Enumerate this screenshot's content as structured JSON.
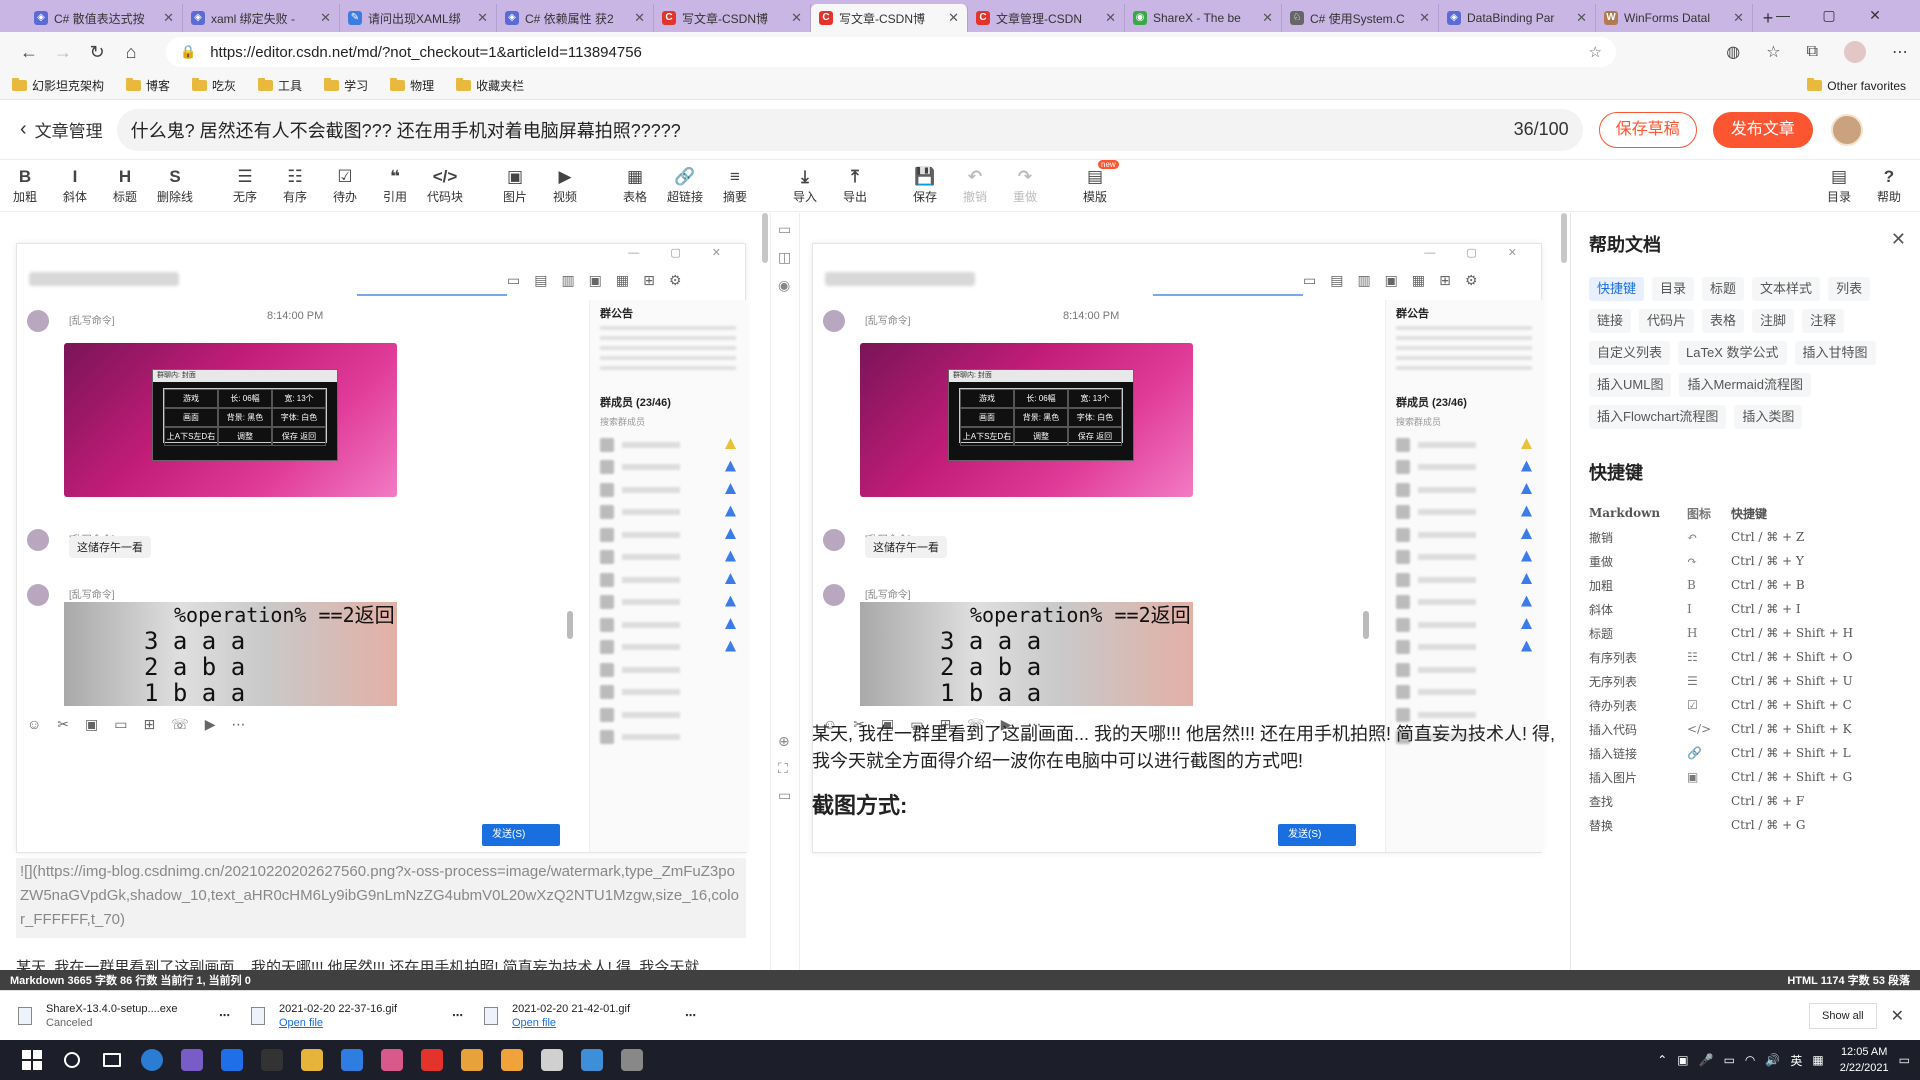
{
  "browser": {
    "tabs": [
      {
        "title": "C# 散值表达式按",
        "fav_color": "#5b6bd6",
        "fav_glyph": "◈",
        "active": false
      },
      {
        "title": "xaml 绑定失败 -",
        "fav_color": "#5b6bd6",
        "fav_glyph": "◈",
        "active": false
      },
      {
        "title": "请问出现XAML绑",
        "fav_color": "#3d7de0",
        "fav_glyph": "✎",
        "active": false
      },
      {
        "title": "C# 依赖属性 获2",
        "fav_color": "#5b6bd6",
        "fav_glyph": "◈",
        "active": false
      },
      {
        "title": "写文章-CSDN博",
        "fav_color": "#e4332a",
        "fav_glyph": "C",
        "active": false
      },
      {
        "title": "写文章-CSDN博",
        "fav_color": "#e4332a",
        "fav_glyph": "C",
        "active": true
      },
      {
        "title": "文章管理-CSDN",
        "fav_color": "#e4332a",
        "fav_glyph": "C",
        "active": false
      },
      {
        "title": "ShareX - The be",
        "fav_color": "#3aa848",
        "fav_glyph": "◉",
        "active": false
      },
      {
        "title": "C# 使用System.C",
        "fav_color": "#666666",
        "fav_glyph": "♘",
        "active": false
      },
      {
        "title": "DataBinding Par",
        "fav_color": "#5b6bd6",
        "fav_glyph": "◈",
        "active": false
      },
      {
        "title": "WinForms Datal",
        "fav_color": "#b07a55",
        "fav_glyph": "W",
        "active": false
      }
    ],
    "new_tab": "+",
    "url": "https://editor.csdn.net/md/?not_checkout=1&articleId=113894756",
    "bookmarks": [
      "幻影坦克架构",
      "博客",
      "吃灰",
      "工具",
      "学习",
      "物理",
      "收藏夹栏"
    ],
    "other_favorites": "Other favorites"
  },
  "editor": {
    "back_label": "文章管理",
    "title": "什么鬼? 居然还有人不会截图??? 还在用手机对着电脑屏幕拍照?????",
    "title_count": "36/100",
    "save_draft": "保存草稿",
    "publish": "发布文章",
    "toolbar": [
      {
        "icon": "B",
        "label": "加粗"
      },
      {
        "icon": "I",
        "label": "斜体"
      },
      {
        "icon": "H",
        "label": "标题"
      },
      {
        "icon": "S",
        "label": "删除线"
      },
      {
        "icon": "☰",
        "label": "无序"
      },
      {
        "icon": "☷",
        "label": "有序"
      },
      {
        "icon": "☑",
        "label": "待办"
      },
      {
        "icon": "❝",
        "label": "引用"
      },
      {
        "icon": "</>",
        "label": "代码块"
      },
      {
        "icon": "▣",
        "label": "图片"
      },
      {
        "icon": "▶",
        "label": "视频"
      },
      {
        "icon": "▦",
        "label": "表格"
      },
      {
        "icon": "🔗",
        "label": "超链接"
      },
      {
        "icon": "≡",
        "label": "摘要"
      },
      {
        "icon": "⤓",
        "label": "导入"
      },
      {
        "icon": "⤒",
        "label": "导出"
      },
      {
        "icon": "💾",
        "label": "保存"
      },
      {
        "icon": "↶",
        "label": "撤销"
      },
      {
        "icon": "↷",
        "label": "重做"
      },
      {
        "icon": "▤",
        "label": "模版"
      }
    ],
    "toolbar_new_badge": "new",
    "toolbar_right": [
      {
        "icon": "▤",
        "label": "目录"
      },
      {
        "icon": "?",
        "label": "帮助"
      }
    ],
    "md_source": "![](https://img-blog.csdnimg.cn/20210220202627560.png?x-oss-process=image/watermark,type_ZmFuZ3poZW5naGVpdGk,shadow_10,text_aHR0cHM6Ly9ibG9nLmNzZG4ubmV0L20wXzQ2NTU1Mzgw,size_16,color_FFFFFF,t_70)",
    "md_body": "某天, 我在一群里看到了这副画面... 我的天哪!!! 他居然!!! 还在用手机拍照! 简直妄为技术人! 得, 我今天就",
    "preview_body": "某天, 我在一群里看到了这副画面... 我的天哪!!! 他居然!!! 还在用手机拍照! 简直妄为技术人! 得, 我今天就全方面得介绍一波你在电脑中可以进行截图的方式吧!",
    "preview_heading": "截图方式:"
  },
  "chat_mock": {
    "time": "8:14:00 PM",
    "sender": "[乱写命令]",
    "bubble": "这储存午一看",
    "group_notice": "群公告",
    "members": "群成员 (23/46)",
    "search_members": "搜索群成员",
    "send": "发送(S)",
    "dialog_title": "群聊内: 封面",
    "dialog_cells": [
      "游戏",
      "长: 06幅",
      "宽: 13个",
      "画面",
      "背景: 黑色",
      "字体: 白色",
      "上A下S左D右",
      "调整",
      "保存 返回"
    ],
    "code_lines": [
      "%operation% ==2返回",
      "3  a  a  a",
      "2  a  b  a",
      "1  b  a  a"
    ]
  },
  "help": {
    "title": "帮助文档",
    "tags": [
      "快捷键",
      "目录",
      "标题",
      "文本样式",
      "列表",
      "链接",
      "代码片",
      "表格",
      "注脚",
      "注释",
      "自定义列表",
      "LaTeX 数学公式",
      "插入甘特图",
      "插入UML图",
      "插入Mermaid流程图",
      "插入Flowchart流程图",
      "插入类图"
    ],
    "shortcut_title": "快捷键",
    "shortcut_headers": [
      "Markdown",
      "图标",
      "快捷键"
    ],
    "shortcuts": [
      {
        "name": "撤销",
        "icon": "↶",
        "key": "Ctrl / ⌘ + Z"
      },
      {
        "name": "重做",
        "icon": "↷",
        "key": "Ctrl / ⌘ + Y"
      },
      {
        "name": "加粗",
        "icon": "B",
        "key": "Ctrl / ⌘ + B"
      },
      {
        "name": "斜体",
        "icon": "I",
        "key": "Ctrl / ⌘ + I"
      },
      {
        "name": "标题",
        "icon": "H",
        "key": "Ctrl / ⌘ + Shift + H"
      },
      {
        "name": "有序列表",
        "icon": "☷",
        "key": "Ctrl / ⌘ + Shift + O"
      },
      {
        "name": "无序列表",
        "icon": "☰",
        "key": "Ctrl / ⌘ + Shift + U"
      },
      {
        "name": "待办列表",
        "icon": "☑",
        "key": "Ctrl / ⌘ + Shift + C"
      },
      {
        "name": "插入代码",
        "icon": "</>",
        "key": "Ctrl / ⌘ + Shift + K"
      },
      {
        "name": "插入链接",
        "icon": "🔗",
        "key": "Ctrl / ⌘ + Shift + L"
      },
      {
        "name": "插入图片",
        "icon": "▣",
        "key": "Ctrl / ⌘ + Shift + G"
      },
      {
        "name": "查找",
        "icon": "",
        "key": "Ctrl / ⌘ + F"
      },
      {
        "name": "替换",
        "icon": "",
        "key": "Ctrl / ⌘ + G"
      }
    ]
  },
  "status": {
    "left": "Markdown  3665 字数  86 行数  当前行 1, 当前列 0",
    "right": "HTML  1174 字数  53 段落"
  },
  "downloads": [
    {
      "name": "ShareX-13.4.0-setup....exe",
      "status": "Canceled",
      "link": false
    },
    {
      "name": "2021-02-20 22-37-16.gif",
      "status": "Open file",
      "link": true
    },
    {
      "name": "2021-02-20 21-42-01.gif",
      "status": "Open file",
      "link": true
    }
  ],
  "show_all": "Show all",
  "taskbar": {
    "apps": [
      "#2b7cd3",
      "#7a5cc8",
      "#1f6fe8",
      "#333333",
      "#e6b43a",
      "#2f7de1",
      "#d95a8a",
      "#e4332a",
      "#e8a23b",
      "#f0a23b",
      "#d0d0d0",
      "#3f8fd8",
      "#888888"
    ],
    "ime": "英",
    "time": "12:05 AM",
    "date": "2/22/2021"
  }
}
